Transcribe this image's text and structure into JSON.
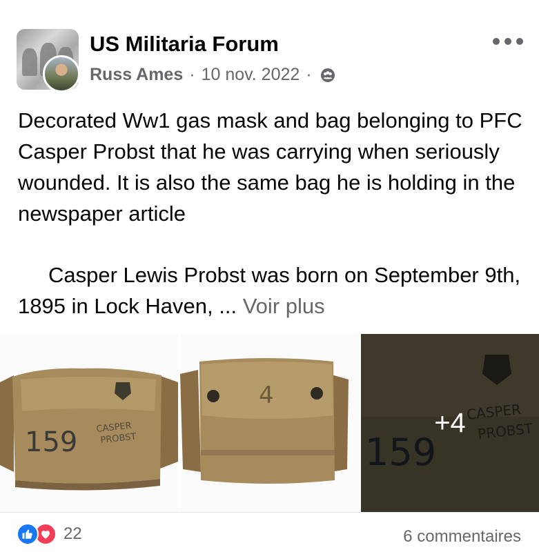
{
  "post": {
    "group_name": "US Militaria Forum",
    "author": "Russ Ames",
    "separator": "·",
    "date": "10 nov. 2022",
    "audience_icon": "group-icon",
    "more_icon": "more-options-icon",
    "text_p1": "Decorated Ww1 gas mask and bag belonging to PFC Casper Probst that he was carrying when seriously wounded. It is also the same bag he is holding in the newspaper article",
    "text_p2": "Casper Lewis Probst was born on September 9th, 1895 in Lock Haven, ...",
    "see_more": "Voir plus"
  },
  "photos": {
    "bag_markings": {
      "number": "159",
      "name_top": "CASPER",
      "name_bottom": "PROBST",
      "flap_mark": "4"
    },
    "more_count": "+4"
  },
  "footer": {
    "reaction_icons": [
      "like-icon",
      "love-icon"
    ],
    "reaction_count": "22",
    "comments": "6 commentaires"
  },
  "colors": {
    "meta_gray": "#65676b",
    "like_blue": "#1877f2",
    "love_red": "#f33e58"
  }
}
